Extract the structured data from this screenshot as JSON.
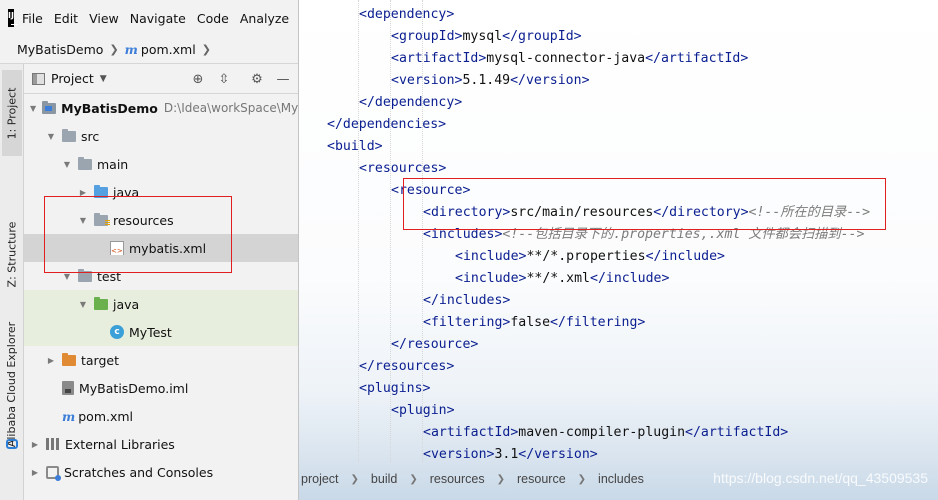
{
  "menu": {
    "logo": "IJ",
    "items": [
      "File",
      "Edit",
      "View",
      "Navigate",
      "Code",
      "Analyze"
    ]
  },
  "breadcrumb": {
    "project": "MyBatisDemo",
    "file": "pom.xml"
  },
  "side_tabs": {
    "project": "1: Project",
    "structure": "Z: Structure",
    "cloud": "Alibaba Cloud Explorer"
  },
  "project_toolbar": {
    "view_label": "Project"
  },
  "tree": [
    {
      "label": "MyBatisDemo",
      "path": "D:\\Idea\\workSpace\\MyBa"
    },
    {
      "label": "src"
    },
    {
      "label": "main"
    },
    {
      "label": "java"
    },
    {
      "label": "resources"
    },
    {
      "label": "mybatis.xml"
    },
    {
      "label": "test"
    },
    {
      "label": "java"
    },
    {
      "label": "MyTest"
    },
    {
      "label": "target"
    },
    {
      "label": "MyBatisDemo.iml"
    },
    {
      "label": "pom.xml"
    },
    {
      "label": "External Libraries"
    },
    {
      "label": "Scratches and Consoles"
    }
  ],
  "code": [
    {
      "segments": [
        {
          "k": "tag",
          "t": "<dependency>"
        }
      ]
    },
    {
      "segments": [
        {
          "k": "tag",
          "t": "<groupId>"
        },
        {
          "k": "txt",
          "t": "mysql"
        },
        {
          "k": "tag",
          "t": "</groupId>"
        }
      ]
    },
    {
      "segments": [
        {
          "k": "tag",
          "t": "<artifactId>"
        },
        {
          "k": "txt",
          "t": "mysql-connector-java"
        },
        {
          "k": "tag",
          "t": "</artifactId>"
        }
      ]
    },
    {
      "segments": [
        {
          "k": "tag",
          "t": "<version>"
        },
        {
          "k": "txt",
          "t": "5.1.49"
        },
        {
          "k": "tag",
          "t": "</version>"
        }
      ]
    },
    {
      "segments": [
        {
          "k": "tag",
          "t": "</dependency>"
        }
      ]
    },
    {
      "segments": [
        {
          "k": "tag",
          "t": "</dependencies>"
        }
      ]
    },
    {
      "segments": [
        {
          "k": "tag",
          "t": "<build>"
        }
      ]
    },
    {
      "segments": [
        {
          "k": "tag",
          "t": "<resources>"
        }
      ]
    },
    {
      "segments": [
        {
          "k": "tag",
          "t": "<resource>"
        }
      ]
    },
    {
      "segments": [
        {
          "k": "tag",
          "t": "<directory>"
        },
        {
          "k": "txt",
          "t": "src/main/resources"
        },
        {
          "k": "tag",
          "t": "</directory>"
        },
        {
          "k": "cmt",
          "t": "<!--所在的目录-->"
        }
      ]
    },
    {
      "segments": [
        {
          "k": "tag",
          "t": "<includes>"
        },
        {
          "k": "cmt",
          "t": "<!--包括目录下的.properties,.xml 文件都会扫描到-->"
        }
      ]
    },
    {
      "segments": [
        {
          "k": "tag",
          "t": "<include>"
        },
        {
          "k": "txt",
          "t": "**/*.properties"
        },
        {
          "k": "tag",
          "t": "</include>"
        }
      ]
    },
    {
      "segments": [
        {
          "k": "tag",
          "t": "<include>"
        },
        {
          "k": "txt",
          "t": "**/*.xml"
        },
        {
          "k": "tag",
          "t": "</include>"
        }
      ]
    },
    {
      "segments": [
        {
          "k": "tag",
          "t": "</includes>"
        }
      ]
    },
    {
      "segments": [
        {
          "k": "tag",
          "t": "<filtering>"
        },
        {
          "k": "txt",
          "t": "false"
        },
        {
          "k": "tag",
          "t": "</filtering>"
        }
      ]
    },
    {
      "segments": [
        {
          "k": "tag",
          "t": "</resource>"
        }
      ]
    },
    {
      "segments": [
        {
          "k": "tag",
          "t": "</resources>"
        }
      ]
    },
    {
      "segments": [
        {
          "k": "tag",
          "t": "<plugins>"
        }
      ]
    },
    {
      "segments": [
        {
          "k": "tag",
          "t": "<plugin>"
        }
      ]
    },
    {
      "segments": [
        {
          "k": "tag",
          "t": "<artifactId>"
        },
        {
          "k": "txt",
          "t": "maven-compiler-plugin"
        },
        {
          "k": "tag",
          "t": "</artifactId>"
        }
      ]
    },
    {
      "segments": [
        {
          "k": "tag",
          "t": "<version>"
        },
        {
          "k": "txt",
          "t": "3.1"
        },
        {
          "k": "tag",
          "t": "</version>"
        }
      ]
    }
  ],
  "status_crumbs": [
    "project",
    "build",
    "resources",
    "resource",
    "includes"
  ],
  "watermark": "https://blog.csdn.net/qq_43509535",
  "colors": {
    "xml_tag": "#0a1e90",
    "comment": "#7b7b7b",
    "highlight_box": "#e02020"
  }
}
